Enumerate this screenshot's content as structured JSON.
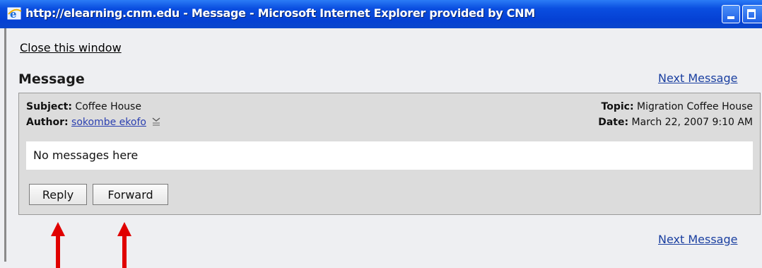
{
  "window": {
    "title": "http://elearning.cnm.edu - Message - Microsoft Internet Explorer provided by CNM",
    "icon": "ie-icon",
    "controls": [
      "minimize-icon",
      "maximize-icon"
    ]
  },
  "page": {
    "close_link": "Close this window",
    "heading": "Message",
    "next_message_top": "Next Message",
    "next_message_bottom": "Next Message"
  },
  "message": {
    "subject_label": "Subject:",
    "subject_value": "Coffee House",
    "author_label": "Author:",
    "author_value": "sokombe ekofo",
    "author_menu_icon": "context-menu-icon",
    "topic_label": "Topic:",
    "topic_value": "Migration Coffee House",
    "date_label": "Date:",
    "date_value": "March 22, 2007 9:10 AM",
    "body": "No messages here"
  },
  "actions": {
    "reply": "Reply",
    "forward": "Forward"
  },
  "annotations": {
    "arrow_color": "#e00000"
  },
  "colors": {
    "titlebar": "#0541d4",
    "link": "#1a3fa0"
  }
}
